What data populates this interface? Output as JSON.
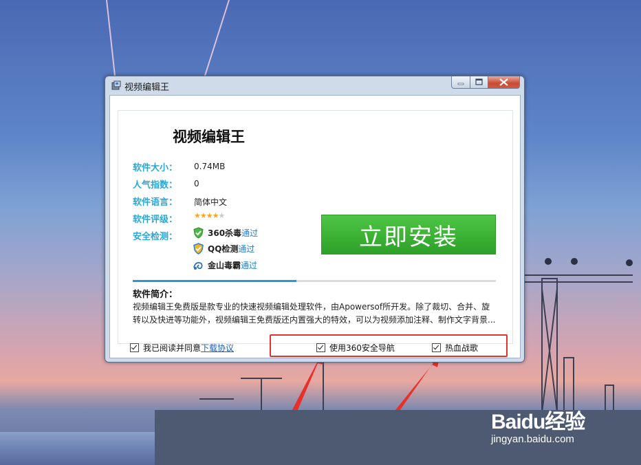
{
  "window": {
    "title": "视频编辑王",
    "app_name": "视频编辑王"
  },
  "info": {
    "size_label": "软件大小：",
    "size_value": "0.74MB",
    "popularity_label": "人气指数：",
    "popularity_value": "0",
    "language_label": "软件语言：",
    "language_value": "简体中文",
    "rating_label": "软件评级：",
    "rating_stars": 4,
    "rating_max": 5,
    "security_label": "安全检测："
  },
  "security_checks": [
    {
      "name": "360杀毒",
      "result": "通过",
      "icon": "360-shield-icon"
    },
    {
      "name": "QQ检测",
      "result": "通过",
      "icon": "qq-shield-icon"
    },
    {
      "name": "金山毒霸",
      "result": "通过",
      "icon": "kingsoft-icon"
    }
  ],
  "install_button": "立即安装",
  "progress": 0.45,
  "intro": {
    "title": "软件简介：",
    "text": "视频编辑王免费版是款专业的快速视频编辑处理软件，由Apowersof所开发。除了裁切、合并、旋转以及快进等功能外，视频编辑王免费版还内置强大的特效，可以为视频添加注释、制作文字背景..."
  },
  "footer": {
    "agree_prefix": "我已阅读并同意",
    "agree_link": "下载协议",
    "option1": "使用360安全导航",
    "option2": "热血战歌"
  },
  "watermark": {
    "brand": "Baidu经验",
    "url": "jingyan.baidu.com"
  },
  "colors": {
    "label_blue": "#29a8d8",
    "install_green": "#3bb234",
    "annotation_red": "#e8302a"
  }
}
